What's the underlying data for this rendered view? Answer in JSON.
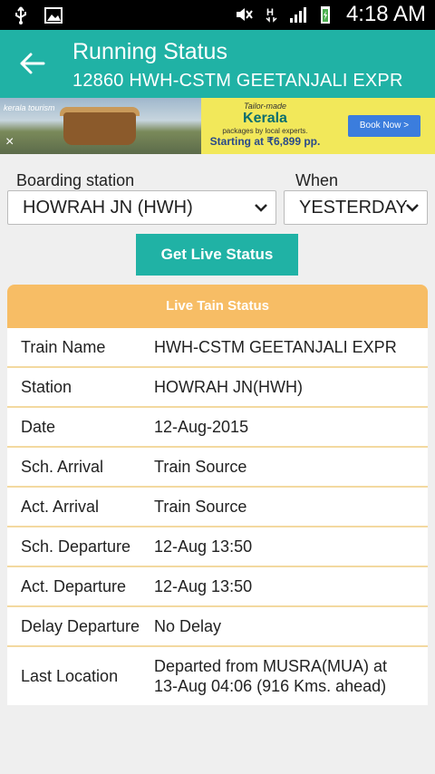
{
  "status_bar": {
    "time": "4:18 AM",
    "icons": [
      "usb-icon",
      "image-icon",
      "mute-icon",
      "h-signal-icon",
      "signal-icon",
      "battery-icon"
    ]
  },
  "app_bar": {
    "title": "Running Status",
    "subtitle": "12860 HWH-CSTM GEETANJALI EXPR"
  },
  "ad": {
    "logo": "kerala tourism",
    "line1": "Tailor-made",
    "line2": "Kerala",
    "line3": "packages by local experts.",
    "line4": "Starting at ₹6,899 pp.",
    "cta": "Book Now >",
    "close": "×"
  },
  "form": {
    "boarding_label": "Boarding station",
    "boarding_value": "HOWRAH JN (HWH)",
    "when_label": "When",
    "when_value": "YESTERDAY",
    "submit": "Get Live Status"
  },
  "status_table": {
    "header": "Live Tain Status",
    "rows": [
      {
        "label": "Train Name",
        "value": "HWH-CSTM GEETANJALI EXPR"
      },
      {
        "label": "Station",
        "value": "HOWRAH JN(HWH)"
      },
      {
        "label": "Date",
        "value": "12-Aug-2015"
      },
      {
        "label": "Sch. Arrival",
        "value": "Train Source"
      },
      {
        "label": "Act. Arrival",
        "value": "Train Source"
      },
      {
        "label": "Sch. Departure",
        "value": "12-Aug 13:50"
      },
      {
        "label": "Act. Departure",
        "value": "12-Aug 13:50"
      },
      {
        "label": "Delay Departure",
        "value": "No Delay"
      },
      {
        "label": "Last Location",
        "value": "Departed from MUSRA(MUA) at\n13-Aug 04:06  (916 Kms. ahead)"
      }
    ]
  },
  "colors": {
    "accent": "#20b2a5",
    "table_header": "#f7bd65",
    "ad_bg": "#f2e85a"
  }
}
